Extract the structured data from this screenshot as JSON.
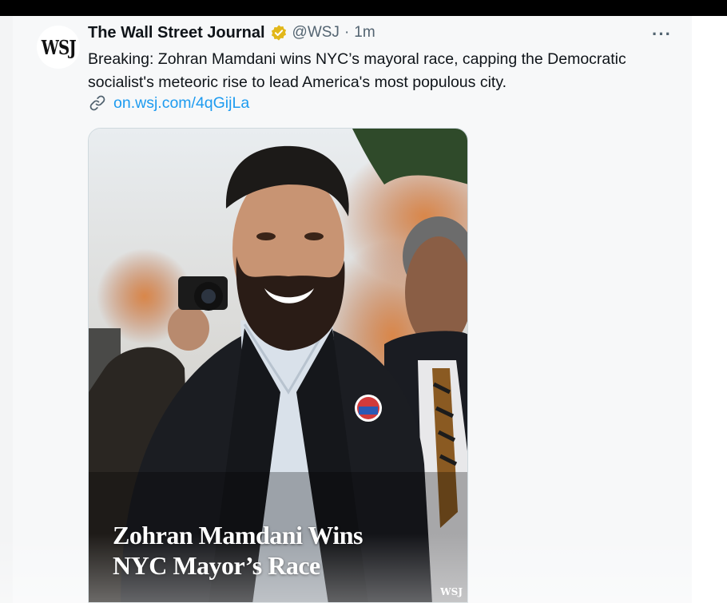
{
  "tweet": {
    "avatar_text": "WSJ",
    "author_name": "The Wall Street Journal",
    "verified_icon": "verified-gold-badge-icon",
    "handle": "@WSJ",
    "separator": "·",
    "time": "1m",
    "more_icon": "more-options-icon",
    "more_label": "···",
    "text": "Breaking: Zohran Mamdani wins NYC’s mayoral race, capping the Democratic socialist's meteoric rise to lead America's most populous city.",
    "link_icon": "link-icon",
    "link_text": "on.wsj.com/4qGijLa",
    "media": {
      "headline_line1": "Zohran Mamdani Wins",
      "headline_line2": "NYC Mayor’s Race",
      "watermark": "WSJ"
    }
  },
  "colors": {
    "link": "#1d9bf0",
    "verified_badge": "#e2b719",
    "text_primary": "#0f1419",
    "text_secondary": "#536471"
  }
}
